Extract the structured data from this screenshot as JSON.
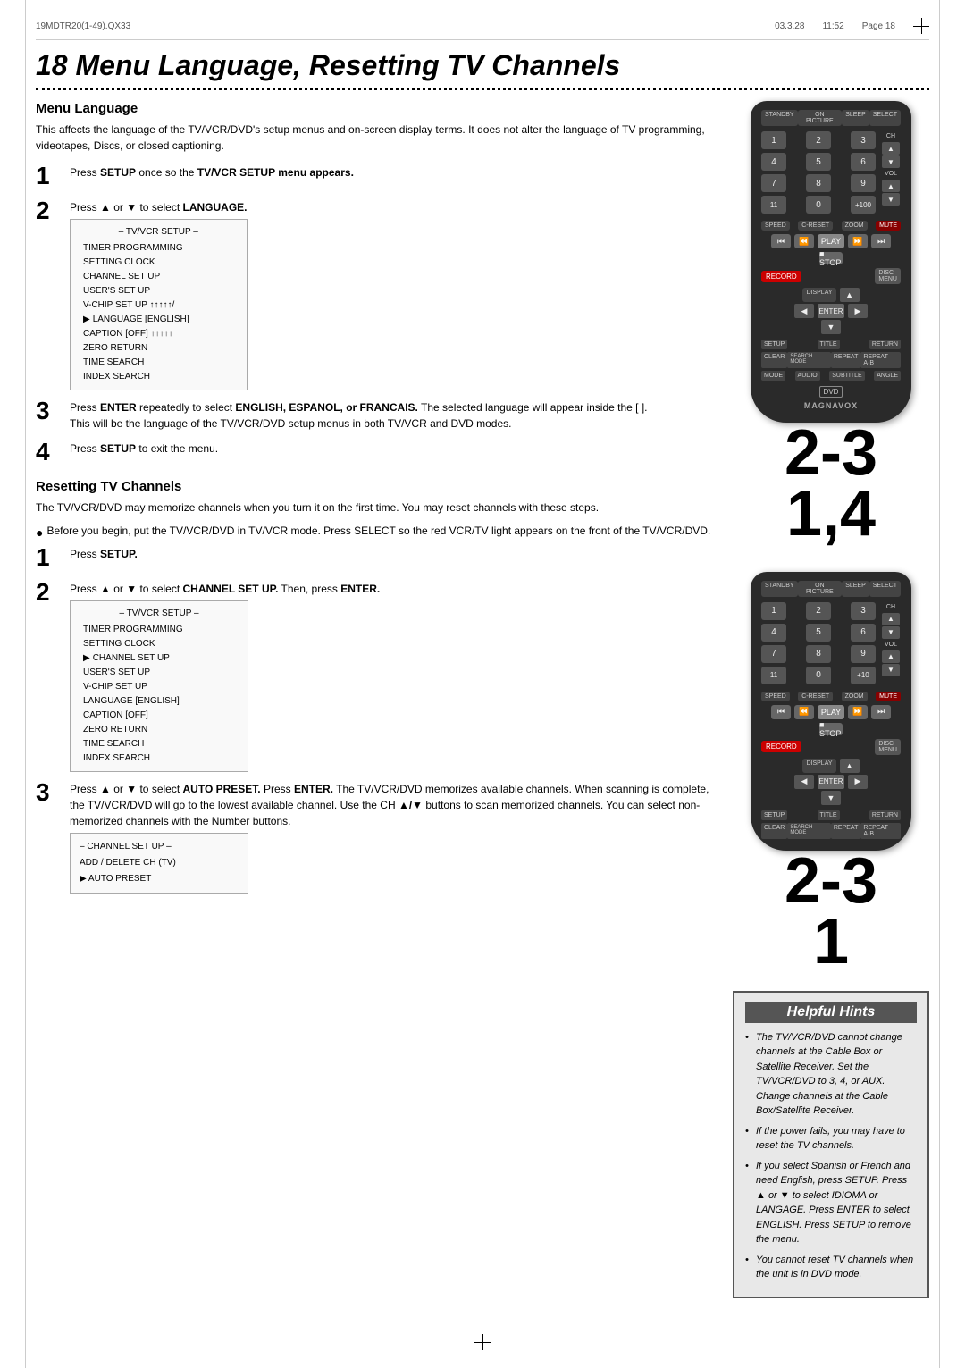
{
  "meta": {
    "file_ref": "19MDTR20(1-49).QX33",
    "date": "03.3.28",
    "time": "11:52",
    "page_label": "Page  18"
  },
  "page_title": "18  Menu Language, Resetting TV Channels",
  "menu_language": {
    "section_title": "Menu Language",
    "intro": "This affects the language of the TV/VCR/DVD's setup menus and on-screen display terms. It does not alter the language of TV programming, videotapes, Discs, or closed captioning.",
    "steps": [
      {
        "number": "1",
        "text": "Press SETUP once so the TV/VCR SETUP menu appears."
      },
      {
        "number": "2",
        "text": "Press ▲ or ▼ to select LANGUAGE."
      },
      {
        "number": "3",
        "text": "Press ENTER repeatedly to select ENGLISH, ESPANOL, or FRANCAIS. The selected language will appear inside the [ ].\nThis will be the language of the TV/VCR/DVD setup menus in both TV/VCR and DVD modes."
      },
      {
        "number": "4",
        "text": "Press SETUP to exit the menu."
      }
    ],
    "step_numbers_display": "2-3\n1,4",
    "menu_items": [
      "– TV/VCR SETUP –",
      "TIMER PROGRAMMING",
      "SETTING CLOCK",
      "CHANNEL SET UP",
      "USER'S SET UP",
      "V-CHIP SET UP ↑ ↑ ↑ ↑ ↑ /",
      "▶ LANGUAGE  [ENGLISH]",
      "CAPTION  [OFF] ↑ ↑ ↑ ↑ ↑",
      "ZERO RETURN",
      "TIME SEARCH",
      "INDEX SEARCH"
    ]
  },
  "resetting_tv_channels": {
    "section_title": "Resetting TV Channels",
    "intro": "The TV/VCR/DVD may memorize channels when you turn it on the first time. You may reset channels with these steps.",
    "bullet": "Before you begin, put the TV/VCR/DVD in TV/VCR mode. Press SELECT so the red VCR/TV light appears on the front of the TV/VCR/DVD.",
    "steps": [
      {
        "number": "1",
        "text": "Press SETUP."
      },
      {
        "number": "2",
        "text": "Press ▲ or ▼ to select CHANNEL SET UP. Then, press ENTER."
      },
      {
        "number": "3",
        "text": "Press ▲ or ▼ to select AUTO PRESET. Press ENTER. The TV/VCR/DVD memorizes available channels. When scanning is complete, the TV/VCR/DVD will go to the lowest available channel. Use the CH ▲/▼ buttons to scan memorized channels. You can select non-memorized channels with the Number buttons."
      }
    ],
    "step_numbers_display": "2-3\n1",
    "menu_items": [
      "– TV/VCR SETUP –",
      "TIMER PROGRAMMING",
      "SETTING CLOCK",
      "▶ CHANNEL SET UP",
      "USER'S SET UP",
      "V-CHIP SET UP",
      "LANGUAGE  [ENGLISH]",
      "CAPTION  [OFF]",
      "ZERO RETURN",
      "TIME SEARCH",
      "INDEX SEARCH"
    ],
    "channel_menu_items": [
      "– CHANNEL SET UP –",
      "ADD / DELETE CH (TV)",
      "▶ AUTO PRESET"
    ]
  },
  "helpful_hints": {
    "title": "Helpful Hints",
    "items": [
      "The TV/VCR/DVD cannot change channels at the Cable Box or Satellite Receiver. Set the TV/VCR/DVD to 3, 4, or AUX. Change channels at the Cable Box/Satellite Receiver.",
      "If the power fails, you may have to reset the TV channels.",
      "If you select Spanish or French and need English, press SETUP. Press ▲ or ▼ to select IDIOMA or LANGAGE. Press ENTER to select ENGLISH. Press SETUP to remove the menu.",
      "You cannot reset TV channels when the unit is in DVD mode."
    ]
  },
  "remote": {
    "top_buttons": [
      "STANDBY",
      "ON PICTURE",
      "SLEEP",
      "SELECT"
    ],
    "num_rows": [
      [
        "1",
        "2",
        "3"
      ],
      [
        "4",
        "5",
        "6"
      ],
      [
        "7",
        "8",
        "9"
      ],
      [
        "11",
        "0",
        "10"
      ]
    ],
    "ch_label": "CH",
    "vol_label": "VOL",
    "speed_label": "SPEED",
    "c_reset_label": "C-RESET",
    "zoom_label": "ZOOM",
    "mute_label": "MUTE",
    "transport": [
      "⏮",
      "⏪",
      "▶",
      "⏩",
      "⏭"
    ],
    "play_label": "PLAY",
    "stop_label": "STOP",
    "record_label": "RECORD",
    "disc_menu_label": "DISC MENU",
    "display_label": "DISPLAY",
    "enter_label": "ENTER",
    "setup_label": "SETUP",
    "title_label": "TITLE",
    "return_label": "RETURN",
    "clear_label": "CLEAR",
    "search_mode_label": "SEARCH MODE",
    "repeat_label": "REPEAT",
    "repeat_ab_label": "REPEAT A-B",
    "mode_label": "MODE",
    "audio_label": "AUDIO",
    "subtitle_label": "SUBTITLE",
    "angle_label": "ANGLE",
    "brand": "MAGNAVOX"
  }
}
